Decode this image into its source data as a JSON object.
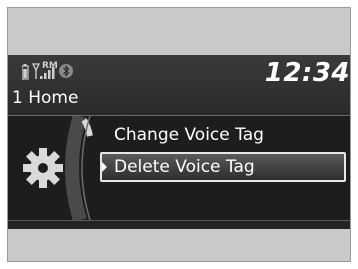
{
  "status": {
    "clock": "12:34",
    "icons": [
      "phone-battery-icon",
      "signal-strength-icon",
      "roaming-icon",
      "bluetooth-icon"
    ],
    "roaming_label": "RM"
  },
  "header": {
    "list_name": "1 Home"
  },
  "menu": {
    "icon": "gear-icon",
    "items": [
      {
        "label": "Change Voice Tag"
      },
      {
        "label": "Delete Voice Tag"
      }
    ],
    "selected_label": "Delete Voice Tag"
  },
  "colors": {
    "screen_background": "#232323",
    "text": "#ffffff",
    "bezel": "#c9c9c9"
  }
}
